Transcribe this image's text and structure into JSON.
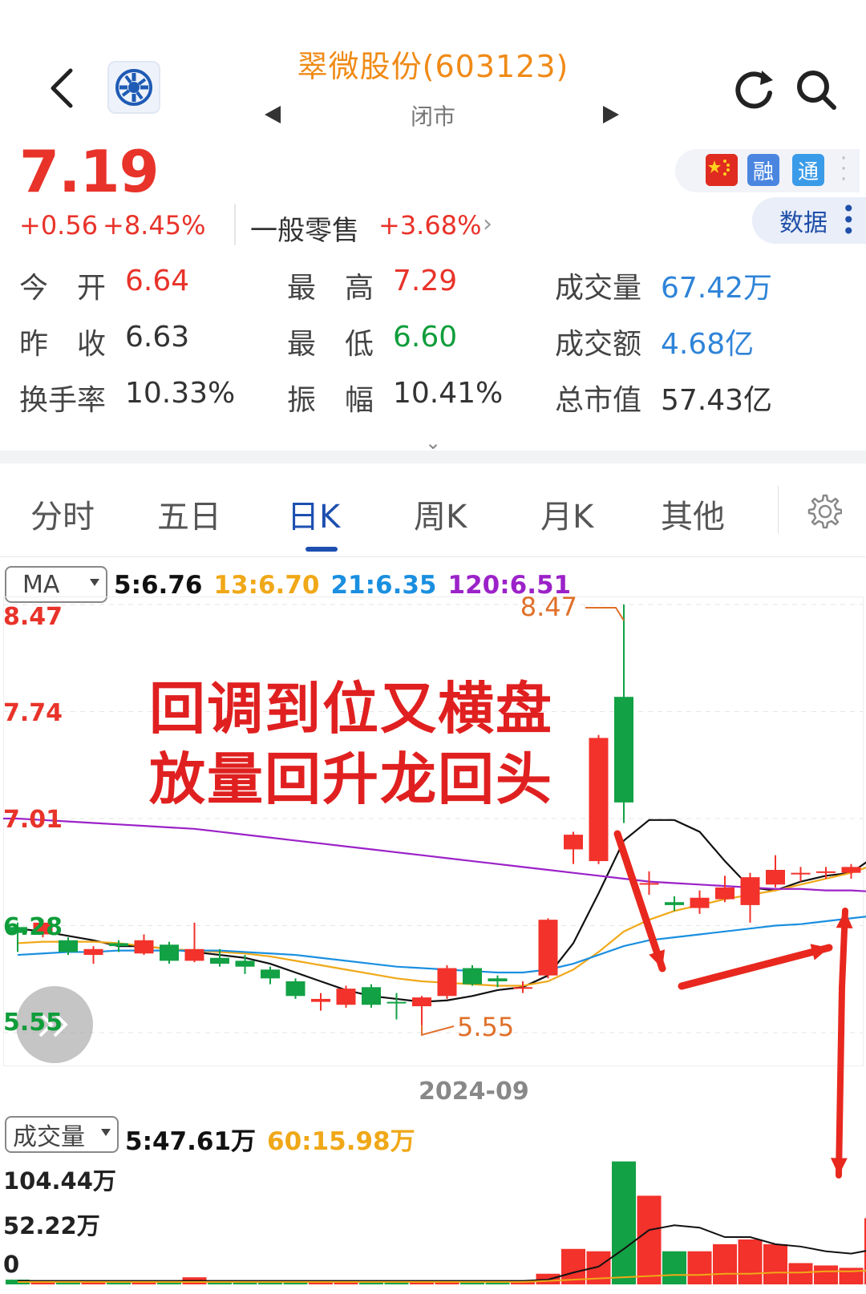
{
  "header": {
    "title": "翠微股份(603123)",
    "status": "闭市"
  },
  "quote": {
    "price": "7.19",
    "change": "+0.56",
    "change_pct": "+8.45%",
    "sector_name": "一般零售",
    "sector_pct": "+3.68%",
    "badges": [
      "融",
      "通"
    ],
    "data_button": "数据"
  },
  "stats": [
    {
      "label": "今　开",
      "value": "6.64",
      "color": "red"
    },
    {
      "label": "最　高",
      "value": "7.29",
      "color": "red"
    },
    {
      "label": "成交量",
      "value": "67.42万",
      "color": "blue"
    },
    {
      "label": "昨　收",
      "value": "6.63",
      "color": "dark"
    },
    {
      "label": "最　低",
      "value": "6.60",
      "color": "green"
    },
    {
      "label": "成交额",
      "value": "4.68亿",
      "color": "blue"
    },
    {
      "label": "换手率",
      "value": "10.33%",
      "color": "dark"
    },
    {
      "label": "振　幅",
      "value": "10.41%",
      "color": "dark"
    },
    {
      "label": "总市值",
      "value": "57.43亿",
      "color": "dark"
    }
  ],
  "tabs": [
    "分时",
    "五日",
    "日K",
    "周K",
    "月K",
    "其他"
  ],
  "active_tab": "日K",
  "ma_selector": "MA",
  "ma_values": [
    {
      "text": "5:6.76",
      "color": "#111111"
    },
    {
      "text": "13:6.70",
      "color": "#f0a818"
    },
    {
      "text": "21:6.35",
      "color": "#1a8fe0"
    },
    {
      "text": "120:6.51",
      "color": "#9b22c8"
    }
  ],
  "vol_selector": "成交量",
  "vol_ma_values": [
    {
      "text": "5:47.61万",
      "color": "#111111"
    },
    {
      "text": "60:15.98万",
      "color": "#f0a818"
    }
  ],
  "annotation": {
    "line1": "回调到位又横盘",
    "line2": "放量回升龙回头"
  },
  "colors": {
    "up": "#f2322b",
    "down": "#12a144",
    "ma5": "#111111",
    "ma13": "#f0a818",
    "ma21": "#1a8fe0",
    "ma120": "#9b22c8"
  },
  "chart_data": {
    "type": "candlestick",
    "price_axis_labels": [
      "8.47",
      "7.74",
      "7.01",
      "6.28",
      "5.55"
    ],
    "ylim": [
      5.55,
      8.47
    ],
    "x_label": "2024-09",
    "max_marker": "8.47",
    "min_marker": "5.55",
    "candles": [
      {
        "o": 6.27,
        "c": 6.23,
        "h": 6.3,
        "l": 6.1
      },
      {
        "o": 6.22,
        "c": 6.3,
        "h": 6.32,
        "l": 6.2
      },
      {
        "o": 6.18,
        "c": 6.1,
        "h": 6.2,
        "l": 6.08
      },
      {
        "o": 6.08,
        "c": 6.12,
        "h": 6.14,
        "l": 6.02
      },
      {
        "o": 6.16,
        "c": 6.14,
        "h": 6.18,
        "l": 6.1
      },
      {
        "o": 6.09,
        "c": 6.18,
        "h": 6.22,
        "l": 6.08
      },
      {
        "o": 6.15,
        "c": 6.04,
        "h": 6.17,
        "l": 6.02
      },
      {
        "o": 6.04,
        "c": 6.12,
        "h": 6.3,
        "l": 6.03
      },
      {
        "o": 6.06,
        "c": 6.02,
        "h": 6.12,
        "l": 6.0
      },
      {
        "o": 6.04,
        "c": 6.0,
        "h": 6.08,
        "l": 5.95
      },
      {
        "o": 5.98,
        "c": 5.92,
        "h": 6.0,
        "l": 5.88
      },
      {
        "o": 5.9,
        "c": 5.8,
        "h": 5.92,
        "l": 5.78
      },
      {
        "o": 5.76,
        "c": 5.78,
        "h": 5.82,
        "l": 5.7
      },
      {
        "o": 5.74,
        "c": 5.85,
        "h": 5.87,
        "l": 5.72
      },
      {
        "o": 5.86,
        "c": 5.74,
        "h": 5.88,
        "l": 5.72
      },
      {
        "o": 5.76,
        "c": 5.75,
        "h": 5.82,
        "l": 5.64
      },
      {
        "o": 5.73,
        "c": 5.79,
        "h": 5.8,
        "l": 5.6
      },
      {
        "o": 5.8,
        "c": 5.99,
        "h": 6.01,
        "l": 5.78
      },
      {
        "o": 5.99,
        "c": 5.88,
        "h": 6.01,
        "l": 5.87
      },
      {
        "o": 5.92,
        "c": 5.9,
        "h": 5.94,
        "l": 5.86
      },
      {
        "o": 5.86,
        "c": 5.86,
        "h": 5.9,
        "l": 5.82
      },
      {
        "o": 5.94,
        "c": 6.32,
        "h": 6.33,
        "l": 5.92
      },
      {
        "o": 6.8,
        "c": 6.9,
        "h": 6.92,
        "l": 6.7
      },
      {
        "o": 6.72,
        "c": 7.56,
        "h": 7.58,
        "l": 6.7
      },
      {
        "o": 7.84,
        "c": 7.12,
        "h": 8.47,
        "l": 6.98
      },
      {
        "o": 6.57,
        "c": 6.57,
        "h": 6.65,
        "l": 6.49
      },
      {
        "o": 6.44,
        "c": 6.42,
        "h": 6.48,
        "l": 6.38
      },
      {
        "o": 6.4,
        "c": 6.47,
        "h": 6.52,
        "l": 6.36
      },
      {
        "o": 6.46,
        "c": 6.54,
        "h": 6.62,
        "l": 6.44
      },
      {
        "o": 6.42,
        "c": 6.61,
        "h": 6.64,
        "l": 6.3
      },
      {
        "o": 6.56,
        "c": 6.66,
        "h": 6.76,
        "l": 6.54
      },
      {
        "o": 6.64,
        "c": 6.64,
        "h": 6.68,
        "l": 6.58
      },
      {
        "o": 6.64,
        "c": 6.65,
        "h": 6.68,
        "l": 6.6
      },
      {
        "o": 6.64,
        "c": 6.68,
        "h": 6.7,
        "l": 6.6
      },
      {
        "o": 6.63,
        "c": 7.19,
        "h": 7.29,
        "l": 6.6
      }
    ],
    "ma_series": [
      {
        "name": "MA5",
        "values": [
          6.26,
          6.24,
          6.21,
          6.18,
          6.14,
          6.14,
          6.12,
          6.1,
          6.08,
          6.06,
          6.02,
          5.96,
          5.9,
          5.84,
          5.8,
          5.78,
          5.76,
          5.77,
          5.8,
          5.84,
          5.86,
          5.94,
          6.16,
          6.5,
          6.86,
          7.0,
          7.0,
          6.92,
          6.72,
          6.54,
          6.52,
          6.58,
          6.62,
          6.64,
          6.76
        ]
      },
      {
        "name": "MA13",
        "values": [
          6.16,
          6.17,
          6.17,
          6.17,
          6.16,
          6.14,
          6.12,
          6.11,
          6.1,
          6.09,
          6.07,
          6.04,
          6.01,
          5.98,
          5.95,
          5.92,
          5.9,
          5.89,
          5.88,
          5.87,
          5.87,
          5.9,
          5.98,
          6.1,
          6.24,
          6.32,
          6.38,
          6.42,
          6.46,
          6.49,
          6.52,
          6.56,
          6.6,
          6.64,
          6.7
        ]
      },
      {
        "name": "MA21",
        "values": [
          6.08,
          6.09,
          6.1,
          6.1,
          6.11,
          6.11,
          6.11,
          6.11,
          6.11,
          6.1,
          6.09,
          6.08,
          6.06,
          6.04,
          6.02,
          6.0,
          5.99,
          5.98,
          5.97,
          5.96,
          5.96,
          5.98,
          6.02,
          6.08,
          6.14,
          6.18,
          6.2,
          6.22,
          6.24,
          6.26,
          6.28,
          6.29,
          6.31,
          6.33,
          6.35
        ]
      },
      {
        "name": "MA120",
        "values": [
          7.01,
          7.0,
          6.99,
          6.98,
          6.97,
          6.96,
          6.95,
          6.94,
          6.92,
          6.9,
          6.88,
          6.86,
          6.84,
          6.82,
          6.8,
          6.78,
          6.76,
          6.74,
          6.72,
          6.7,
          6.68,
          6.66,
          6.64,
          6.62,
          6.6,
          6.58,
          6.57,
          6.56,
          6.55,
          6.54,
          6.53,
          6.53,
          6.52,
          6.52,
          6.51
        ]
      }
    ],
    "volume_axis_labels": [
      "104.44万",
      "52.22万",
      "0"
    ],
    "volume_max": 104.44,
    "volume": [
      4,
      3,
      3,
      3,
      3,
      3,
      3,
      6,
      3,
      3,
      3,
      3,
      3,
      3,
      3,
      3,
      3,
      3,
      3,
      3,
      3,
      9,
      30,
      28,
      104,
      75,
      28,
      28,
      34,
      38,
      34,
      18,
      16,
      14,
      56
    ],
    "volume_ma5": [
      3,
      3,
      3,
      3,
      3,
      3,
      3,
      3,
      3,
      3,
      3,
      3,
      3,
      3,
      3,
      3,
      3,
      3,
      3,
      3,
      3,
      4,
      10,
      15,
      30,
      46,
      50,
      48,
      40,
      40,
      34,
      32,
      28,
      26,
      30
    ],
    "volume_ma60": [
      2,
      2,
      2,
      2,
      2,
      2,
      2,
      2,
      2,
      2,
      2,
      2,
      2,
      2,
      2,
      2,
      2,
      2,
      2,
      2,
      2,
      3,
      4,
      5,
      6,
      7,
      8,
      8,
      9,
      9,
      10,
      10,
      11,
      11,
      12
    ]
  }
}
